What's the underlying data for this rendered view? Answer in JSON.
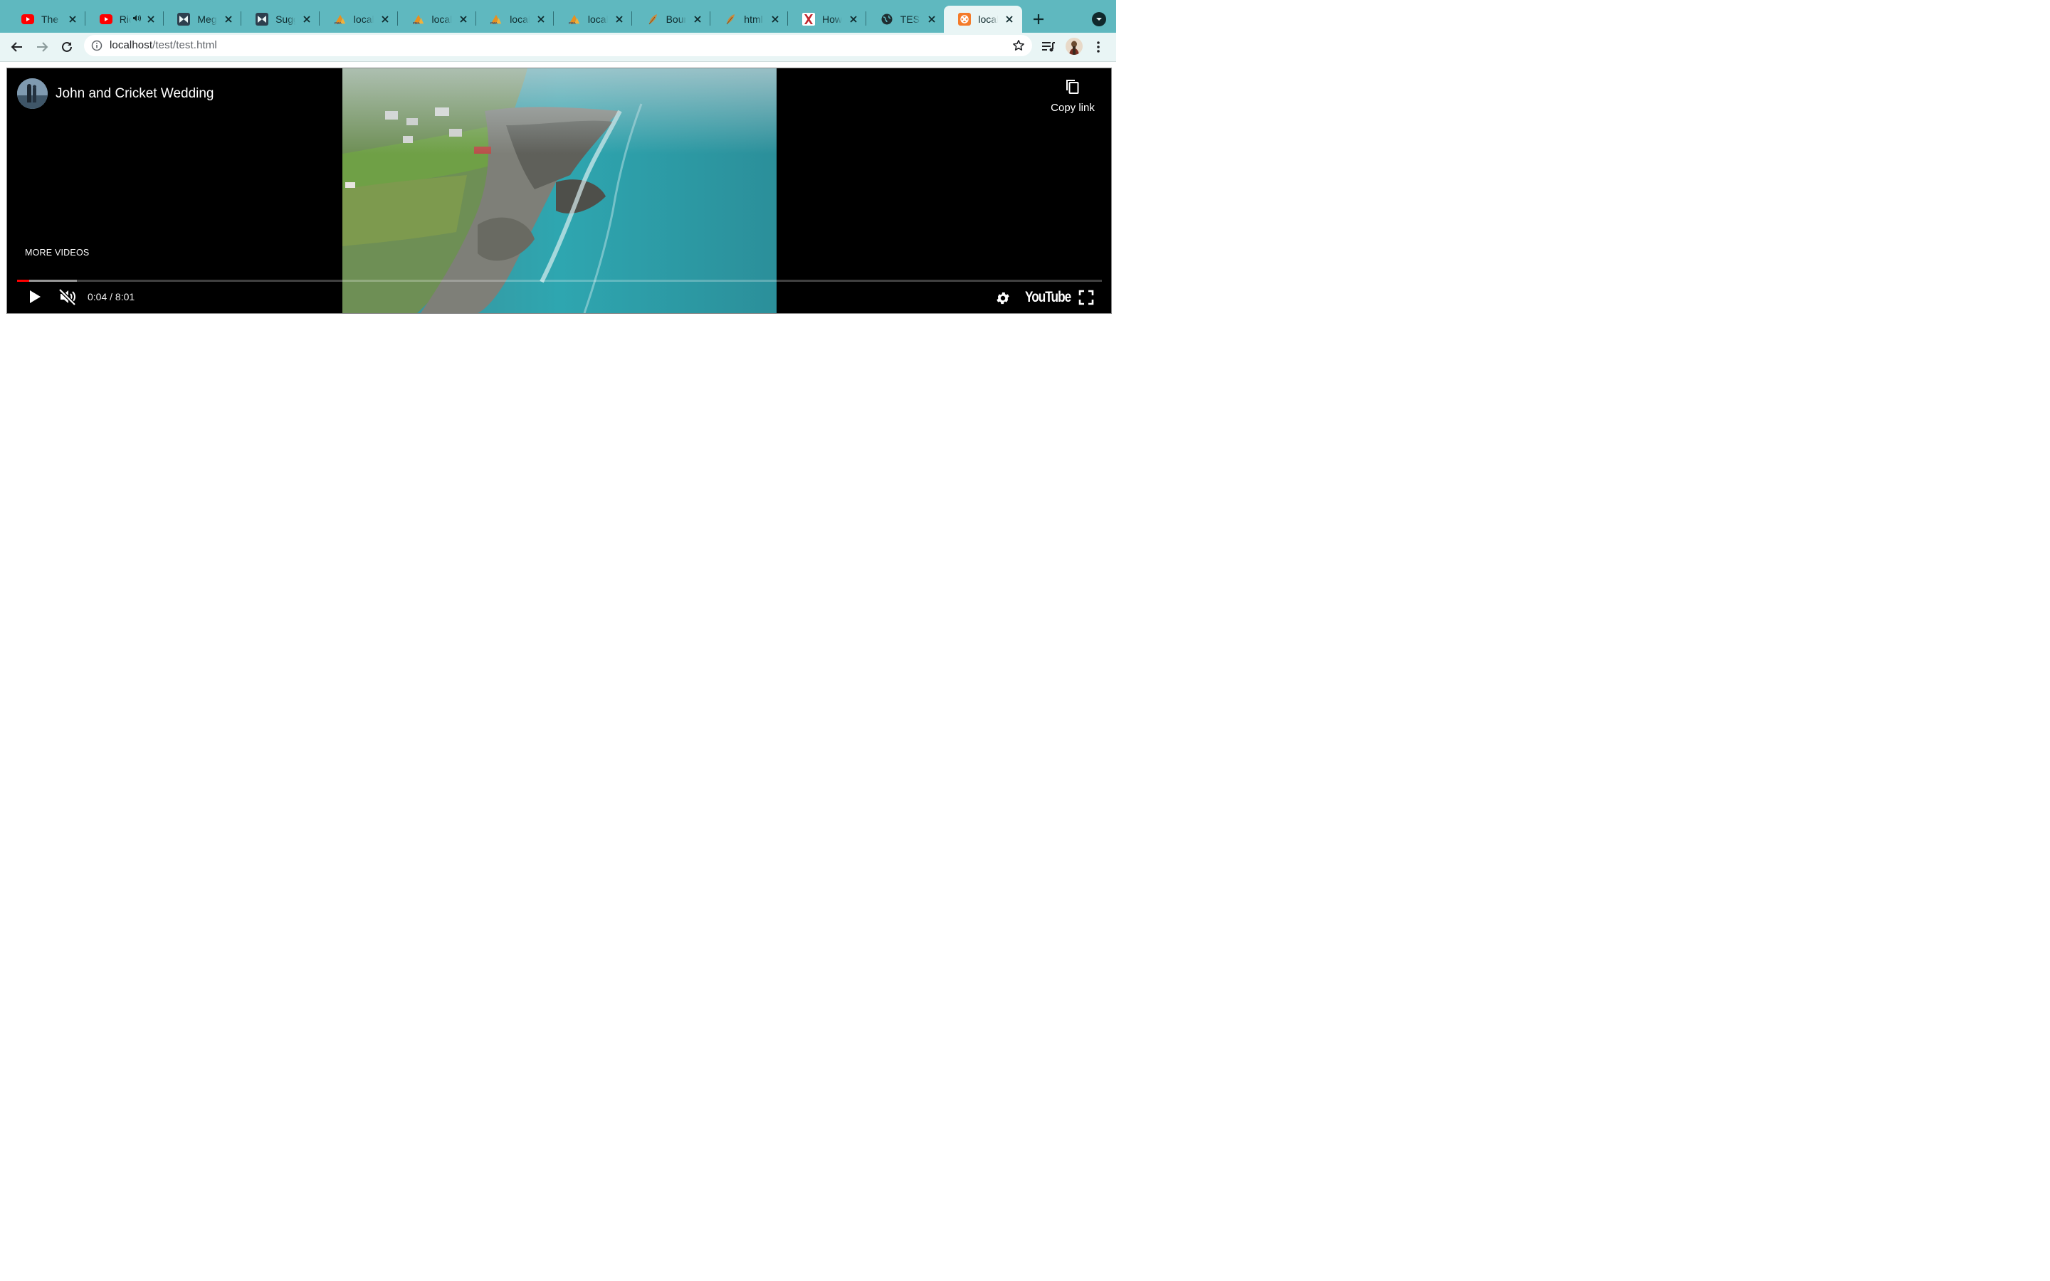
{
  "browser": {
    "tabs": [
      {
        "title": "The Ga",
        "icon": "youtube-icon",
        "audible": false,
        "active": false
      },
      {
        "title": "Ric",
        "icon": "youtube-icon",
        "audible": true,
        "active": false
      },
      {
        "title": "Mega",
        "icon": "bowtie-icon",
        "audible": false,
        "active": false
      },
      {
        "title": "Sugge",
        "icon": "bowtie-icon",
        "audible": false,
        "active": false
      },
      {
        "title": "localhc",
        "icon": "phpmyadmin-icon",
        "audible": false,
        "active": false
      },
      {
        "title": "localhc",
        "icon": "phpmyadmin-icon",
        "audible": false,
        "active": false
      },
      {
        "title": "localhc",
        "icon": "phpmyadmin-icon",
        "audible": false,
        "active": false
      },
      {
        "title": "localhc",
        "icon": "phpmyadmin-icon",
        "audible": false,
        "active": false
      },
      {
        "title": "Bounti",
        "icon": "feather-icon",
        "audible": false,
        "active": false
      },
      {
        "title": "html -",
        "icon": "feather-icon",
        "audible": false,
        "active": false
      },
      {
        "title": "How T",
        "icon": "x-logo-icon",
        "audible": false,
        "active": false
      },
      {
        "title": "TEST",
        "icon": "globe-icon",
        "audible": false,
        "active": false
      },
      {
        "title": "localhc",
        "icon": "xampp-icon",
        "audible": false,
        "active": true
      }
    ],
    "address": {
      "host": "localhost",
      "path": "/test/test.html"
    }
  },
  "player": {
    "title": "John and Cricket Wedding",
    "copy_link_label": "Copy link",
    "more_videos_label": "MORE VIDEOS",
    "time_display": "0:04 / 8:01",
    "played_fraction": 0.011,
    "buffered_fraction": 0.055,
    "brand": "YouTube",
    "muted": true
  },
  "colors": {
    "tab_strip": "#5fb8bf",
    "toolbar": "#e9f5f5",
    "progress_played": "#ff0000",
    "player_bg": "#000000"
  }
}
